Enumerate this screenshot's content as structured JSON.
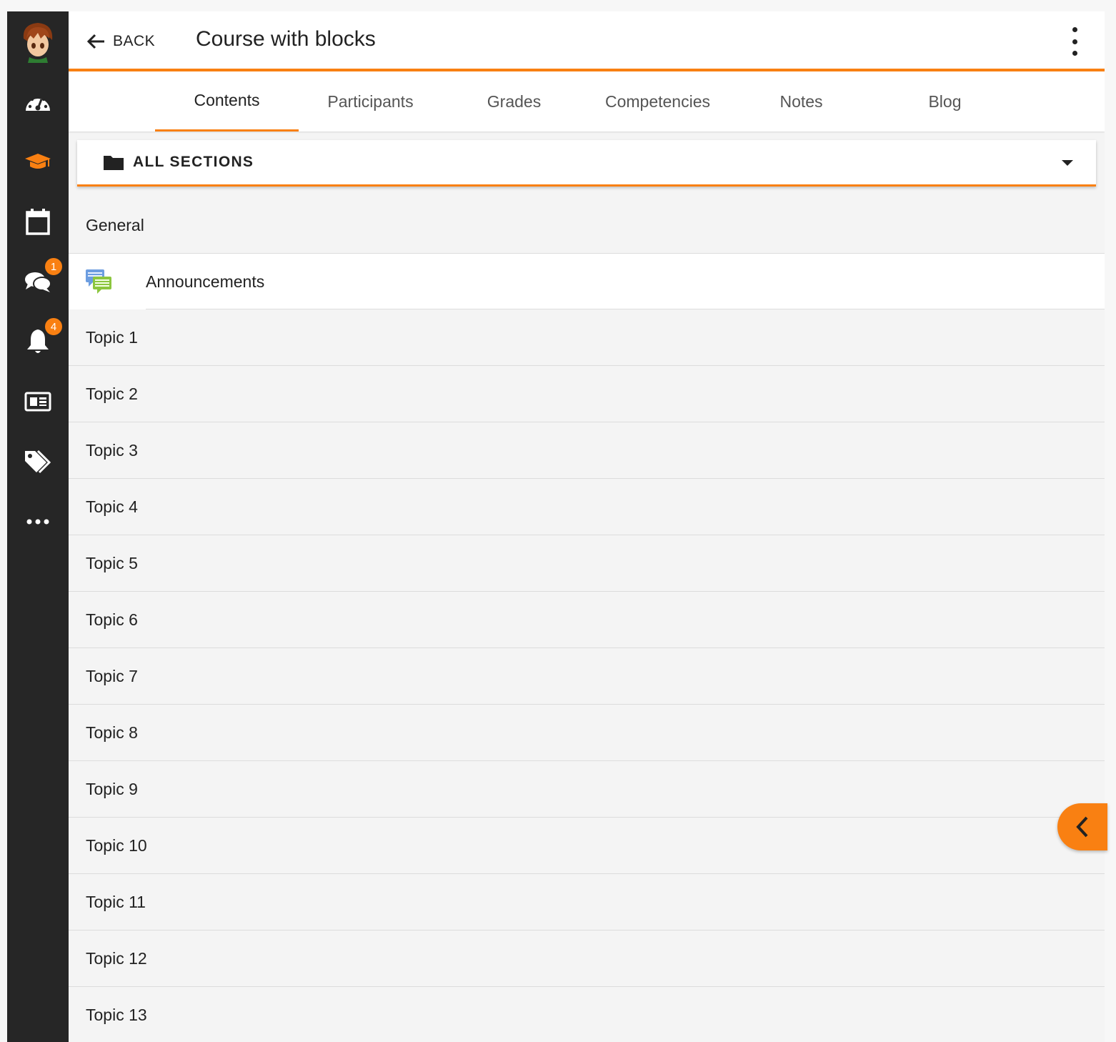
{
  "header": {
    "back_label": "BACK",
    "title": "Course with blocks"
  },
  "tabs": [
    {
      "label": "Contents",
      "active": true
    },
    {
      "label": "Participants",
      "active": false
    },
    {
      "label": "Grades",
      "active": false
    },
    {
      "label": "Competencies",
      "active": false
    },
    {
      "label": "Notes",
      "active": false
    },
    {
      "label": "Blog",
      "active": false
    }
  ],
  "section_selector": {
    "label": "ALL SECTIONS",
    "icon": "folder-icon"
  },
  "sidebar": {
    "items": [
      {
        "name": "avatar"
      },
      {
        "name": "dashboard",
        "icon": "dashboard-icon"
      },
      {
        "name": "courses",
        "icon": "graduation-cap-icon",
        "active": true
      },
      {
        "name": "calendar",
        "icon": "calendar-icon"
      },
      {
        "name": "messages",
        "icon": "chat-icon",
        "badge": "1"
      },
      {
        "name": "notifications",
        "icon": "bell-icon",
        "badge": "4"
      },
      {
        "name": "news",
        "icon": "newspaper-icon"
      },
      {
        "name": "tags",
        "icon": "tags-icon"
      },
      {
        "name": "more",
        "icon": "ellipsis-icon"
      }
    ]
  },
  "sections": {
    "general": "General",
    "announcements": "Announcements",
    "topics": [
      "Topic 1",
      "Topic 2",
      "Topic 3",
      "Topic 4",
      "Topic 5",
      "Topic 6",
      "Topic 7",
      "Topic 8",
      "Topic 9",
      "Topic 10",
      "Topic 11",
      "Topic 12",
      "Topic 13"
    ]
  },
  "colors": {
    "accent": "#f98012",
    "sidebar_bg": "#262626",
    "list_bg": "#f4f4f4"
  }
}
